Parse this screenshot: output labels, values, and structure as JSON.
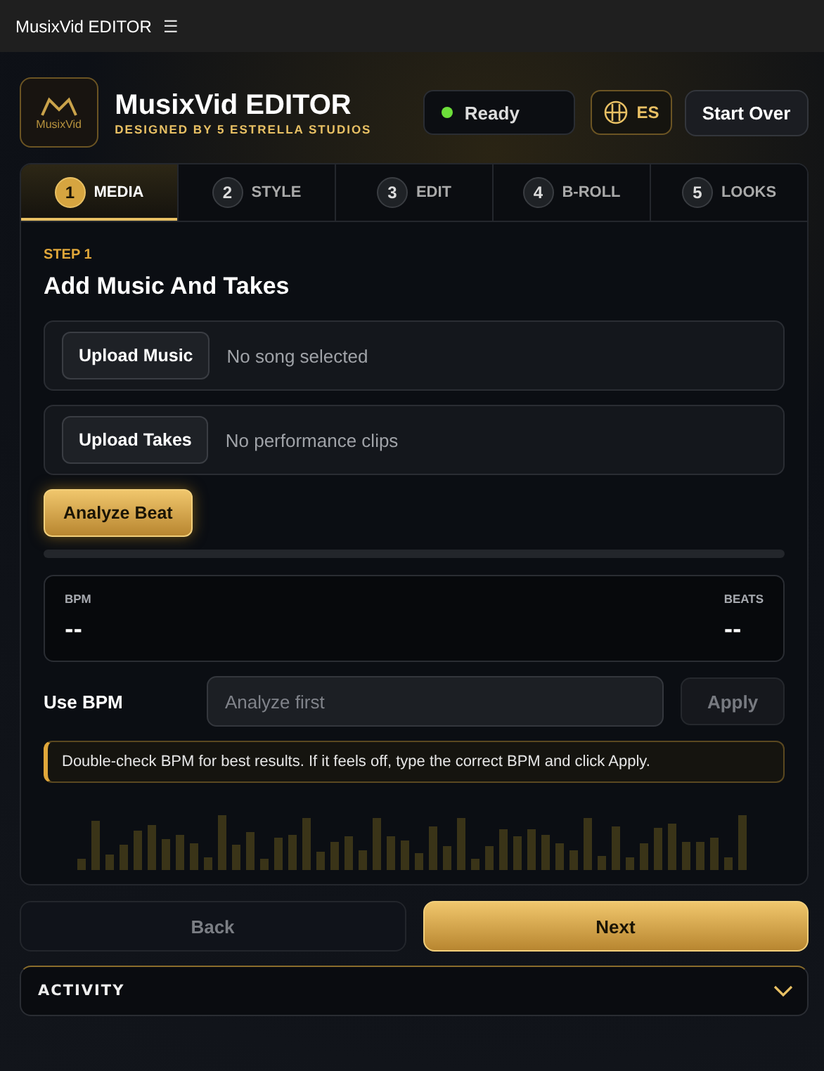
{
  "topbar": {
    "title": "MusixVid EDITOR",
    "menu_glyph": "☰"
  },
  "header": {
    "logo_text": "MusixVid",
    "title": "MusixVid EDITOR",
    "subtitle": "DESIGNED BY 5 ESTRELLA STUDIOS",
    "status": {
      "label": "Ready",
      "on": true
    },
    "language": "ES",
    "start_over": "Start Over"
  },
  "tabs": [
    {
      "number": "1",
      "label": "MEDIA",
      "selected": true
    },
    {
      "number": "2",
      "label": "STYLE",
      "selected": false
    },
    {
      "number": "3",
      "label": "EDIT",
      "selected": false
    },
    {
      "number": "4",
      "label": "B-ROLL",
      "selected": false
    },
    {
      "number": "5",
      "label": "LOOKS",
      "selected": false
    }
  ],
  "step": {
    "eyebrow": "STEP 1",
    "title": "Add Music And Takes",
    "uploads": [
      {
        "button": "Upload Music",
        "status": "No song selected"
      },
      {
        "button": "Upload Takes",
        "status": "No performance clips"
      }
    ],
    "analyze": "Analyze Beat",
    "progress": {
      "level": 0
    },
    "stats": [
      {
        "label": "BPM",
        "value": "--"
      },
      {
        "label": "BEATS",
        "value": "--"
      }
    ],
    "use_bpm": {
      "label": "Use BPM",
      "placeholder": "Analyze first",
      "apply": "Apply",
      "disabled": true
    },
    "note": "Double-check BPM for best results. If it feels off, type the correct BPM and click Apply."
  },
  "nav": {
    "back": {
      "label": "Back",
      "disabled": true
    },
    "next": {
      "label": "Next",
      "disabled": false
    }
  },
  "activity": {
    "label": "ACTIVITY",
    "expanded": false
  }
}
